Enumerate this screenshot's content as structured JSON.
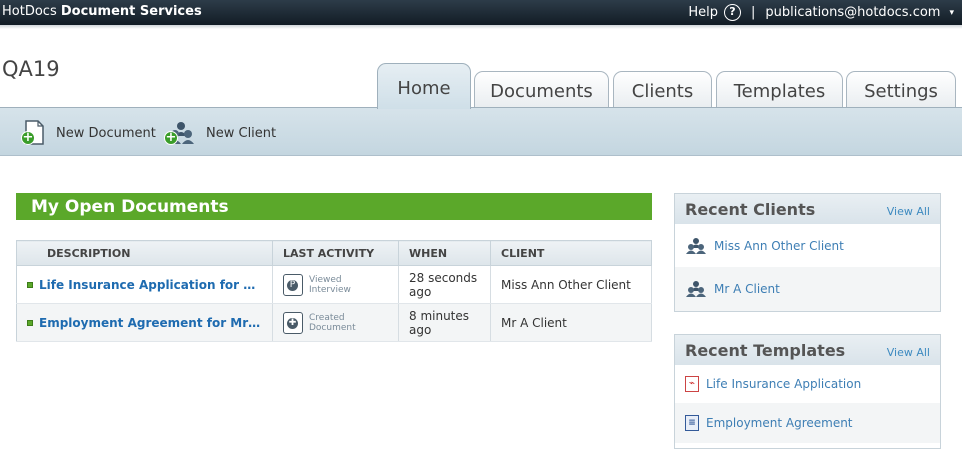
{
  "topbar": {
    "brand_prefix": "HotDocs",
    "brand_name": "Document Services",
    "help_label": "Help",
    "help_icon": "?",
    "separator": "|",
    "user_email": "publications@hotdocs.com",
    "user_caret": "▾"
  },
  "page": {
    "title": "QA19"
  },
  "tabs": [
    {
      "label": "Home",
      "active": true
    },
    {
      "label": "Documents"
    },
    {
      "label": "Clients"
    },
    {
      "label": "Templates"
    },
    {
      "label": "Settings"
    }
  ],
  "toolbar": {
    "new_document": "New Document",
    "new_client": "New Client",
    "plus_glyph": "+"
  },
  "open_documents": {
    "title": "My Open Documents",
    "columns": [
      "DESCRIPTION",
      "LAST ACTIVITY",
      "WHEN",
      "CLIENT"
    ],
    "rows": [
      {
        "description": "Life Insurance Application for Miss A...",
        "activity_line1": "Viewed",
        "activity_line2": "Interview",
        "activity_icon": "viewed-interview-icon",
        "activity_glyph": "P",
        "when_line1": "28 seconds",
        "when_line2": "ago",
        "client": "Miss Ann Other Client"
      },
      {
        "description": "Employment Agreement for Mr A Cli...",
        "activity_line1": "Created",
        "activity_line2": "Document",
        "activity_icon": "created-document-icon",
        "activity_glyph": "✚",
        "when_line1": "8 minutes",
        "when_line2": "ago",
        "client": "Mr A Client"
      }
    ]
  },
  "recent_clients": {
    "title": "Recent Clients",
    "view_all": "View All",
    "items": [
      {
        "name": "Miss Ann Other Client"
      },
      {
        "name": "Mr A Client"
      }
    ]
  },
  "recent_templates": {
    "title": "Recent Templates",
    "view_all": "View All",
    "items": [
      {
        "name": "Life Insurance Application",
        "icon": "pdf-icon"
      },
      {
        "name": "Employment Agreement",
        "icon": "word-doc-icon"
      }
    ]
  },
  "colors": {
    "topbar": "#1a2630",
    "green_header": "#5ba82a",
    "link_blue": "#1e6bb0",
    "toolbar": "#cddde6"
  }
}
